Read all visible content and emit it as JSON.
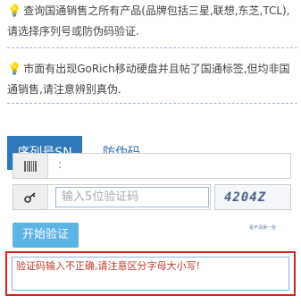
{
  "notices": [
    {
      "text": "查询国通销售之所有产品(品牌包括三星,联想,东芝,TCL),请选择序列号或防伪码验证."
    },
    {
      "text": "市面有出现GoRich移动硬盘并且帖了国通标签,但均非国通销售,请注意辨别真伪."
    }
  ],
  "tabs": {
    "serial": "序列号SN",
    "anticounterfeit": "防伪码"
  },
  "form": {
    "sn_separator": ":",
    "code_placeholder": "输入5位验证码",
    "captcha_text": "4204Z",
    "captcha_refresh": "看不清换一张",
    "verify_button": "开始验证"
  },
  "result": {
    "message": "验证码输入不正确,请注意区分字母大小写!"
  },
  "colors": {
    "tab_active": "#3079b8",
    "button": "#5cb3e6",
    "error_border": "#d62222",
    "bulb": "#e2a50d"
  }
}
